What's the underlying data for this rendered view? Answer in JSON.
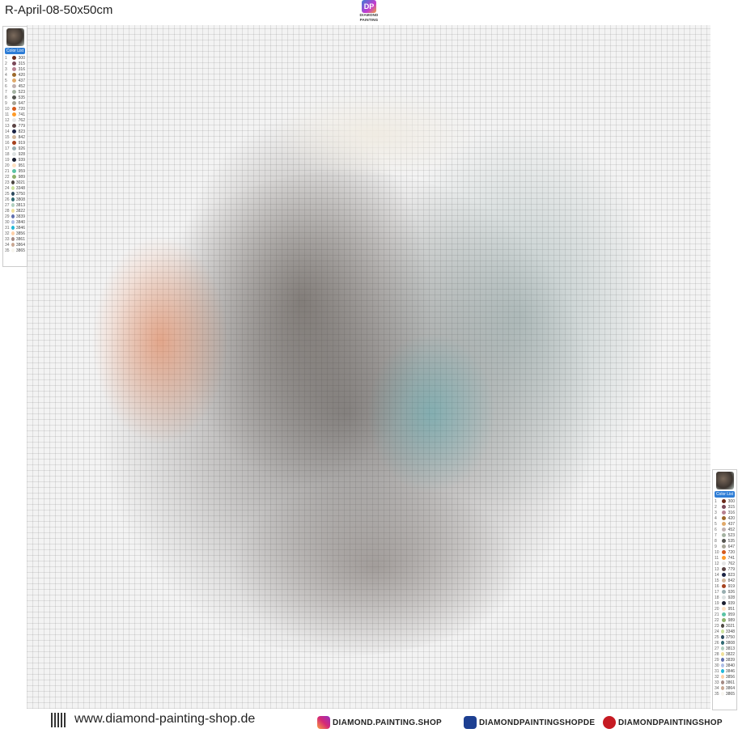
{
  "header": {
    "title": "R-April-08-50x50cm",
    "logo_mark": "DP",
    "logo_text": "DIAMOND PAINTING"
  },
  "legend": {
    "label": "Color List",
    "colors": [
      {
        "n": "1",
        "code": "300",
        "hex": "#6b2a1a"
      },
      {
        "n": "2",
        "code": "315",
        "hex": "#7b4a5a"
      },
      {
        "n": "3",
        "code": "316",
        "hex": "#b7808f"
      },
      {
        "n": "4",
        "code": "420",
        "hex": "#9d6a2c"
      },
      {
        "n": "5",
        "code": "437",
        "hex": "#e0a96a"
      },
      {
        "n": "6",
        "code": "452",
        "hex": "#c0b0b0"
      },
      {
        "n": "7",
        "code": "523",
        "hex": "#a5b3a2"
      },
      {
        "n": "8",
        "code": "535",
        "hex": "#555550"
      },
      {
        "n": "9",
        "code": "647",
        "hex": "#a7a597"
      },
      {
        "n": "10",
        "code": "720",
        "hex": "#d65a1c"
      },
      {
        "n": "11",
        "code": "741",
        "hex": "#ff9a26"
      },
      {
        "n": "12",
        "code": "762",
        "hex": "#e6e6e6"
      },
      {
        "n": "13",
        "code": "779",
        "hex": "#5c4444"
      },
      {
        "n": "14",
        "code": "823",
        "hex": "#1b2344"
      },
      {
        "n": "15",
        "code": "842",
        "hex": "#d2b89c"
      },
      {
        "n": "16",
        "code": "919",
        "hex": "#a6421e"
      },
      {
        "n": "17",
        "code": "926",
        "hex": "#98aeb0"
      },
      {
        "n": "18",
        "code": "928",
        "hex": "#dde2e2"
      },
      {
        "n": "19",
        "code": "939",
        "hex": "#1b1f30"
      },
      {
        "n": "20",
        "code": "951",
        "hex": "#ffe1c2"
      },
      {
        "n": "21",
        "code": "959",
        "hex": "#5ac4a5"
      },
      {
        "n": "22",
        "code": "989",
        "hex": "#8eb06a"
      },
      {
        "n": "23",
        "code": "3021",
        "hex": "#4e4842"
      },
      {
        "n": "24",
        "code": "3348",
        "hex": "#cbe29c"
      },
      {
        "n": "25",
        "code": "3750",
        "hex": "#2e4c5f"
      },
      {
        "n": "26",
        "code": "3808",
        "hex": "#306a72"
      },
      {
        "n": "27",
        "code": "3813",
        "hex": "#b2d0c0"
      },
      {
        "n": "28",
        "code": "3822",
        "hex": "#f0e09a"
      },
      {
        "n": "29",
        "code": "3839",
        "hex": "#6070ae"
      },
      {
        "n": "30",
        "code": "3840",
        "hex": "#b0c0e8"
      },
      {
        "n": "31",
        "code": "3846",
        "hex": "#22b8d8"
      },
      {
        "n": "32",
        "code": "3856",
        "hex": "#ffd0a8"
      },
      {
        "n": "33",
        "code": "3861",
        "hex": "#a58a84"
      },
      {
        "n": "34",
        "code": "3864",
        "hex": "#c9a893"
      },
      {
        "n": "35",
        "code": "3865",
        "hex": "#f8f6f0"
      }
    ]
  },
  "footer": {
    "website": "www.diamond-painting-shop.de",
    "instagram": "DIAMOND.PAINTING.SHOP",
    "facebook": "DIAMONDPAINTINGSHOPDE",
    "pinterest": "DIAMONDPAINTINGSHOP"
  }
}
